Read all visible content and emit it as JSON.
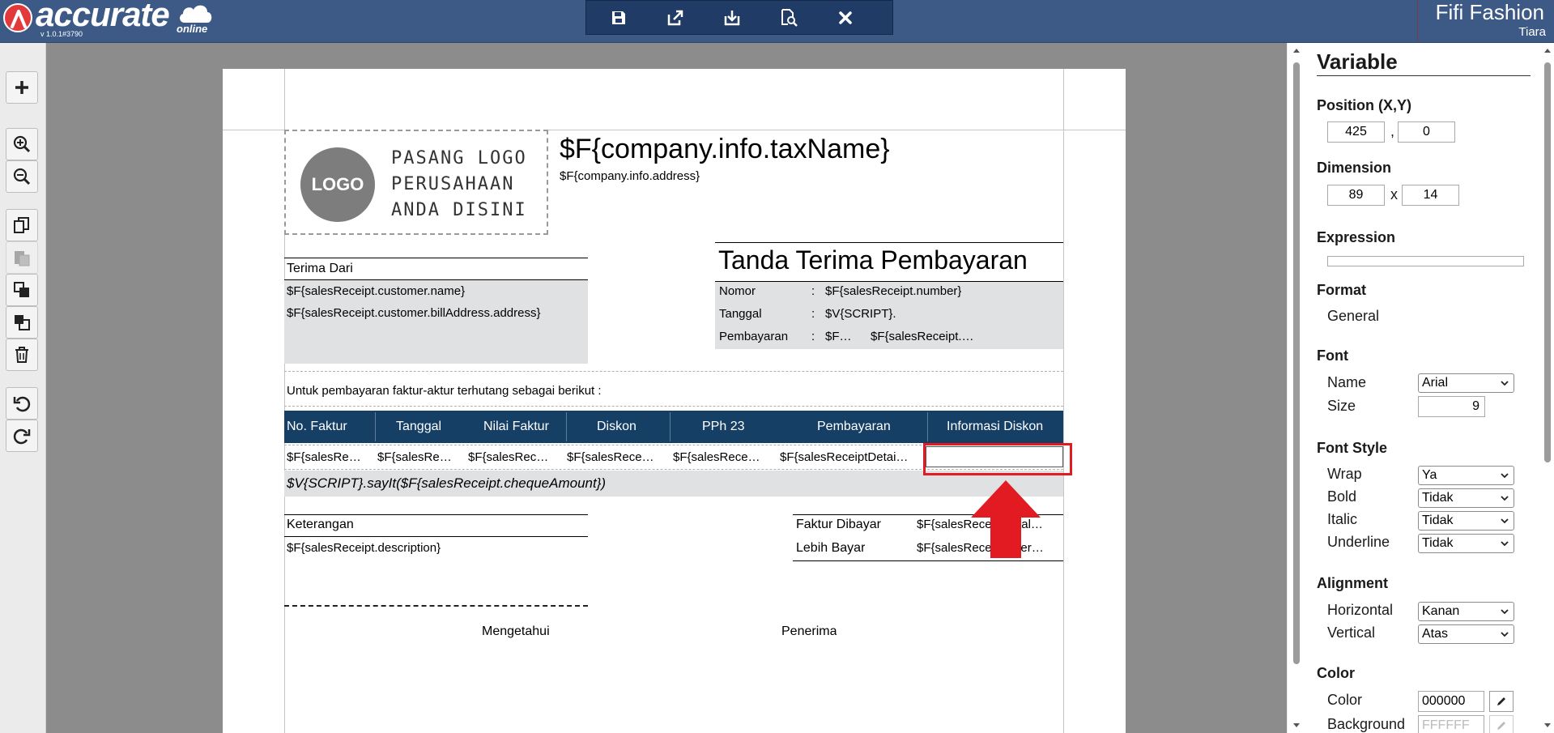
{
  "topbar": {
    "brand": "accurate",
    "brand_suffix": "online",
    "version": "v 1.0.1#3790",
    "company": "Fifi Fashion",
    "user": "Tiara",
    "toolbar_icons": [
      "save-icon",
      "export-icon",
      "import-icon",
      "preview-icon",
      "close-icon"
    ]
  },
  "left_toolbar": {
    "icons": [
      "plus-icon",
      "zoom-in-icon",
      "zoom-out-icon",
      "copy-icon",
      "paste-icon",
      "bring-front-icon",
      "send-back-icon",
      "delete-icon",
      "undo-icon",
      "redo-icon"
    ]
  },
  "page": {
    "logo_badge": "LOGO",
    "logo_text": "PASANG LOGO\nPERUSAHAAN\nANDA DISINI",
    "company_tax_name": "$F{company.info.taxName}",
    "company_address": "$F{company.info.address}",
    "terima_dari_label": "Terima Dari",
    "customer_name": "$F{salesReceipt.customer.name}",
    "customer_address": "$F{salesReceipt.customer.billAddress.address}",
    "doc_title": "Tanda Terima Pembayaran",
    "info_rows": [
      {
        "label": "Nomor",
        "sep": ":",
        "value": "$F{salesReceipt.number}"
      },
      {
        "label": "Tanggal",
        "sep": ":",
        "value": "$V{SCRIPT}."
      },
      {
        "label": "Pembayaran",
        "sep": ":",
        "value": "$F…",
        "value2": "$F{salesReceipt.…"
      }
    ],
    "intro_text": "Untuk pembayaran faktur-aktur terhutang sebagai berikut :",
    "table_headers": [
      "No. Faktur",
      "Tanggal",
      "Nilai Faktur",
      "Diskon",
      "PPh 23",
      "Pembayaran",
      "Informasi Diskon"
    ],
    "table_row": [
      "$F{salesRe…",
      "$F{salesRe…",
      "$F{salesRec…",
      "$F{salesRece…",
      "$F{salesRece…",
      "$F{salesReceiptDetai…",
      ""
    ],
    "say_it": "$V{SCRIPT}.sayIt($F{salesReceipt.chequeAmount})",
    "keterangan_label": "Keterangan",
    "keterangan_value": "$F{salesReceipt.description}",
    "summary": [
      {
        "label": "Faktur Dibayar",
        "value": "$F{salesReceipt.total…"
      },
      {
        "label": "Lebih Bayar",
        "value": "$F{salesReceipt.over…"
      }
    ],
    "mengetahui": "Mengetahui",
    "penerima": "Penerima"
  },
  "panel": {
    "title": "Variable",
    "position_label": "Position (X,Y)",
    "pos_x": "425",
    "pos_sep": ",",
    "pos_y": "0",
    "dimension_label": "Dimension",
    "dim_w": "89",
    "dim_sep": "x",
    "dim_h": "14",
    "expression_label": "Expression",
    "expression_value": "",
    "format_label": "Format",
    "format_value": "General",
    "font_label": "Font",
    "font_name_label": "Name",
    "font_name_value": "Arial",
    "font_size_label": "Size",
    "font_size_value": "9",
    "font_style_label": "Font Style",
    "wrap_label": "Wrap",
    "wrap_value": "Ya",
    "bold_label": "Bold",
    "bold_value": "Tidak",
    "italic_label": "Italic",
    "italic_value": "Tidak",
    "underline_label": "Underline",
    "underline_value": "Tidak",
    "alignment_label": "Alignment",
    "horizontal_label": "Horizontal",
    "horizontal_value": "Kanan",
    "vertical_label": "Vertical",
    "vertical_value": "Atas",
    "color_section_label": "Color",
    "color_label": "Color",
    "color_value": "000000",
    "background_label": "Background",
    "background_value": "FFFFFF"
  },
  "colors": {
    "topbar": "#3d5a86",
    "table_header": "#163f66",
    "highlight": "#e21a22",
    "gray_block": "#e0e1e3"
  }
}
